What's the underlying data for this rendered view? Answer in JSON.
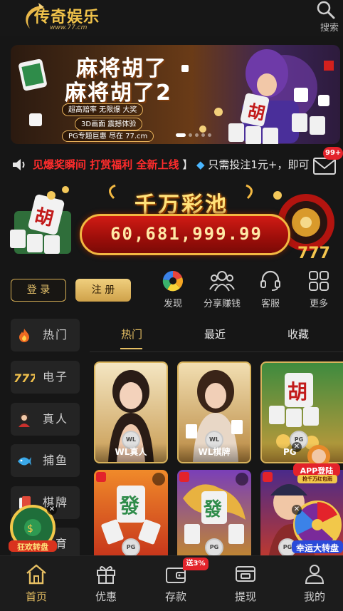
{
  "header": {
    "logo_text": "传奇娱乐",
    "logo_url_text": "www.77.cm",
    "search_label": "搜索"
  },
  "banner": {
    "line1": "麻将胡了",
    "line2": "麻将胡了2",
    "pill1": "超高赔率 无限爆 大奖",
    "pill2": "3D画面 震撼体验",
    "pill3": "PG专题巨惠 尽在 77.cm",
    "slide_count": 5,
    "active_slide": 1
  },
  "marquee": {
    "part1": "见爆奖瞬间 打赏福利 全新上线",
    "bracket": "】",
    "part2": "只需投注1元+，即可",
    "mail_badge": "99+"
  },
  "jackpot": {
    "title": "千万彩池",
    "value": "60,681,999.99"
  },
  "auth": {
    "login": "登 录",
    "register": "注 册"
  },
  "quick_links": [
    {
      "label": "发现",
      "icon": "aperture-icon"
    },
    {
      "label": "分享赚钱",
      "icon": "people-icon"
    },
    {
      "label": "客服",
      "icon": "headset-icon"
    },
    {
      "label": "更多",
      "icon": "grid-icon"
    }
  ],
  "sidebar": {
    "items": [
      {
        "label": "热门",
        "icon": "fire-icon"
      },
      {
        "label": "电子",
        "icon": "slot-777-icon"
      },
      {
        "label": "真人",
        "icon": "dealer-icon"
      },
      {
        "label": "捕鱼",
        "icon": "fish-icon"
      },
      {
        "label": "棋牌",
        "icon": "chess-icon"
      },
      {
        "label": "体育",
        "icon": "sports-icon"
      }
    ]
  },
  "tabs": [
    {
      "label": "热门",
      "active": true
    },
    {
      "label": "最近",
      "active": false
    },
    {
      "label": "收藏",
      "active": false
    }
  ],
  "games": [
    {
      "name": "WL真人",
      "provider": "WL"
    },
    {
      "name": "WL棋牌",
      "provider": "WL"
    },
    {
      "name": "PG",
      "provider": "PG"
    }
  ],
  "games_row2": [
    {
      "provider": "PG"
    },
    {
      "provider": "PG"
    },
    {
      "provider": "PG"
    }
  ],
  "floating": {
    "left_label": "狂欢转盘",
    "app_label": "APP登陆",
    "app_sub": "抢千万红包雨",
    "wheel_label": "幸运大转盘"
  },
  "bottom_nav": [
    {
      "label": "首页",
      "active": true
    },
    {
      "label": "优惠",
      "active": false
    },
    {
      "label": "存款",
      "active": false,
      "badge": "送3%"
    },
    {
      "label": "提现",
      "active": false
    },
    {
      "label": "我的",
      "active": false
    }
  ],
  "colors": {
    "accent_gold": "#e6bf63",
    "background": "#161616",
    "red": "#e3232b"
  }
}
